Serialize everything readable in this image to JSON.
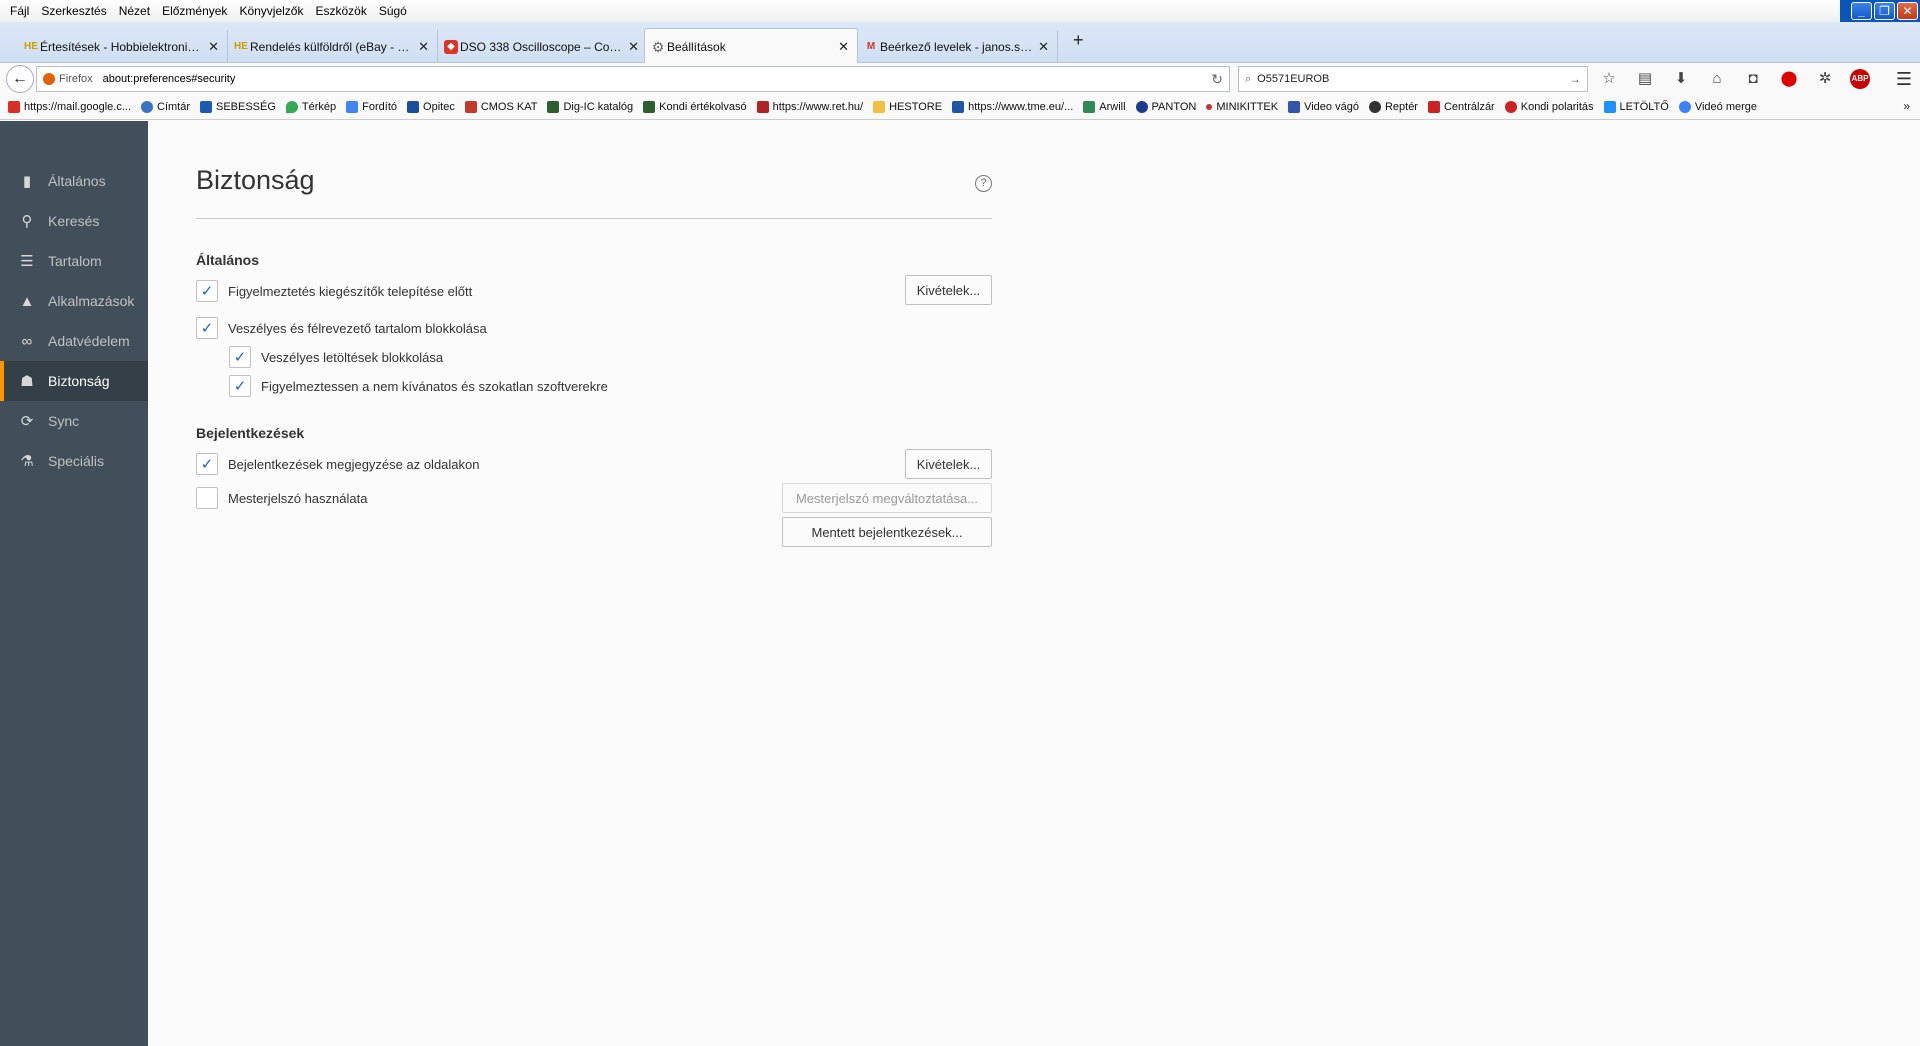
{
  "menubar": {
    "items": [
      "Fájl",
      "Szerkesztés",
      "Nézet",
      "Előzmények",
      "Könyvjelzők",
      "Eszközök",
      "Súgó"
    ]
  },
  "tabs": [
    {
      "label": "Értesítések - Hobbielektronika...",
      "icon": "HE"
    },
    {
      "label": "Rendelés külföldről (eBay - Pa...",
      "icon": "HE"
    },
    {
      "label": "DSO 338 Oscilloscope – Comp...",
      "icon": "shield-icon"
    },
    {
      "label": "Beállítások",
      "icon": "gear-icon"
    },
    {
      "label": "Beérkező levelek - janos.scha...",
      "icon": "gmail-icon"
    }
  ],
  "navbar": {
    "identity_label": "Firefox",
    "url": "about:preferences#security",
    "search_value": "O5571EUROB"
  },
  "bookmarks": [
    {
      "label": "https://mail.google.c...",
      "color": "#d93025"
    },
    {
      "label": "Címtár",
      "color": "#3b73c6"
    },
    {
      "label": "SEBESSÉG",
      "color": "#1c5ab3"
    },
    {
      "label": "Térkép",
      "color": "#34a853"
    },
    {
      "label": "Fordító",
      "color": "#4285f4"
    },
    {
      "label": "Opitec",
      "color": "#1a4d9c"
    },
    {
      "label": "CMOS KAT",
      "color": "#c0392b"
    },
    {
      "label": "Dig-IC katalóg",
      "color": "#2f5f2f"
    },
    {
      "label": "Kondi értékolvasó",
      "color": "#2f5f2f"
    },
    {
      "label": "https://www.ret.hu/",
      "color": "#b22222"
    },
    {
      "label": "HESTORE",
      "color": "#f0c040"
    },
    {
      "label": "https://www.tme.eu/...",
      "color": "#2255aa"
    },
    {
      "label": "Arwill",
      "color": "#2e8b57"
    },
    {
      "label": "PANTON",
      "color": "#1e3a8a"
    },
    {
      "label": "MINIKITTEK",
      "color": "#cc3333"
    },
    {
      "label": "Video vágó",
      "color": "#3355aa"
    },
    {
      "label": "Reptér",
      "color": "#333333"
    },
    {
      "label": "Centrálzár",
      "color": "#cc2222"
    },
    {
      "label": "Kondi polaritás",
      "color": "#cc2222"
    },
    {
      "label": "LETÖLTŐ",
      "color": "#1e90ff"
    },
    {
      "label": "Videó merge",
      "color": "#3b82f6"
    }
  ],
  "sidebar": {
    "items": [
      {
        "label": "Általános",
        "icon": "general-icon",
        "glyph": "▮"
      },
      {
        "label": "Keresés",
        "icon": "search-icon",
        "glyph": "🔍"
      },
      {
        "label": "Tartalom",
        "icon": "content-icon",
        "glyph": "☰"
      },
      {
        "label": "Alkalmazások",
        "icon": "applications-icon",
        "glyph": "▲"
      },
      {
        "label": "Adatvédelem",
        "icon": "privacy-mask-icon",
        "glyph": "∞"
      },
      {
        "label": "Biztonság",
        "icon": "security-lock-icon",
        "glyph": "☗"
      },
      {
        "label": "Sync",
        "icon": "sync-icon",
        "glyph": "⟳"
      },
      {
        "label": "Speciális",
        "icon": "advanced-icon",
        "glyph": "⚗"
      }
    ],
    "selected_index": 5
  },
  "main": {
    "title": "Biztonság",
    "general": {
      "heading": "Általános",
      "warn_addons": {
        "label": "Figyelmeztetés kiegészítők telepítése előtt",
        "checked": true
      },
      "exceptions_button": "Kivételek...",
      "block_dangerous": {
        "label": "Veszélyes és félrevezető tartalom blokkolása",
        "checked": true
      },
      "block_downloads": {
        "label": "Veszélyes letöltések blokkolása",
        "checked": true
      },
      "warn_unwanted": {
        "label": "Figyelmeztessen a nem kívánatos és szokatlan szoftverekre",
        "checked": true
      }
    },
    "logins": {
      "heading": "Bejelentkezések",
      "remember_logins": {
        "label": "Bejelentkezések megjegyzése az oldalakon",
        "checked": true
      },
      "exceptions_button": "Kivételek...",
      "master_password": {
        "label": "Mesterjelszó használata",
        "checked": false
      },
      "change_master_button": "Mesterjelszó megváltoztatása...",
      "saved_logins_button": "Mentett bejelentkezések..."
    }
  }
}
